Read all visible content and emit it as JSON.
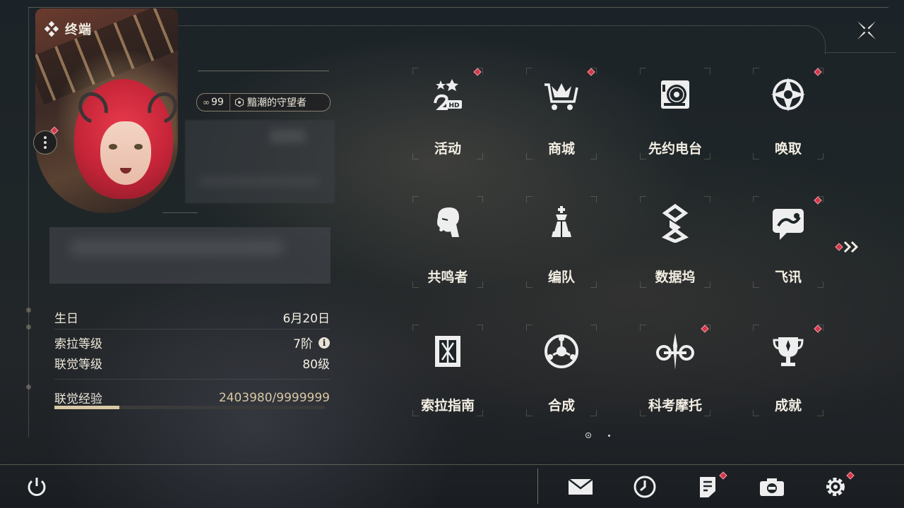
{
  "header": {
    "title": "终端"
  },
  "profile": {
    "level": "99",
    "title_badge": "黯潮的守望者"
  },
  "stats": [
    {
      "label": "生日",
      "value": "6月20日"
    },
    {
      "label": "索拉等级",
      "value": "7阶"
    },
    {
      "label": "联觉等级",
      "value": "80级"
    }
  ],
  "experience": {
    "label": "联觉经验",
    "value": "2403980/9999999",
    "progress": 0.2404
  },
  "menu": [
    {
      "label": "活动",
      "icon": "event-icon",
      "badge": true
    },
    {
      "label": "商城",
      "icon": "shop-cart-icon",
      "badge": true
    },
    {
      "label": "先约电台",
      "icon": "radio-icon",
      "badge": false
    },
    {
      "label": "唤取",
      "icon": "convene-icon",
      "badge": true
    },
    {
      "label": "共鸣者",
      "icon": "resonator-icon",
      "badge": false
    },
    {
      "label": "编队",
      "icon": "team-chess-icon",
      "badge": false
    },
    {
      "label": "数据坞",
      "icon": "data-bank-icon",
      "badge": false
    },
    {
      "label": "飞讯",
      "icon": "message-icon",
      "badge": true
    },
    {
      "label": "索拉指南",
      "icon": "guide-book-icon",
      "badge": false
    },
    {
      "label": "合成",
      "icon": "synthesis-icon",
      "badge": false
    },
    {
      "label": "科考摩托",
      "icon": "motorcycle-icon",
      "badge": true
    },
    {
      "label": "成就",
      "icon": "trophy-icon",
      "badge": true
    }
  ],
  "pagination": {
    "pages": 2,
    "current": 1
  },
  "bottom_bar": {
    "icons": [
      "power-icon",
      "mail-icon",
      "clock-icon",
      "notice-icon",
      "camera-icon",
      "settings-gear-icon"
    ]
  },
  "colors": {
    "badge": "#d4364a",
    "accent": "#d8c8a5",
    "text": "#f3eee3"
  }
}
